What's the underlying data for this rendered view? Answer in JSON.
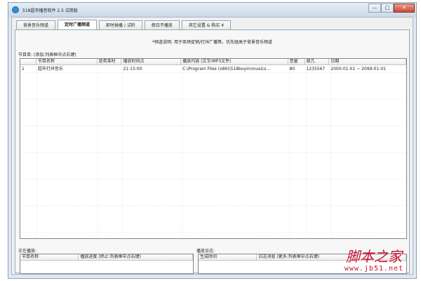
{
  "window": {
    "title": "518超市播音软件 2.5 试用版",
    "min_label": "—",
    "max_label": "□",
    "close_label": "✕"
  },
  "tabs": [
    {
      "label": "背景音乐频道",
      "active": false
    },
    {
      "label": "定时广播频道",
      "active": true
    },
    {
      "label": "即时插播 / 试听",
      "active": false
    },
    {
      "label": "假日不播放",
      "active": false
    },
    {
      "label": "其它设置 & 购买 ¥",
      "active": false
    }
  ],
  "main": {
    "hint": "*频道说明: 用于商场促销/打烊广播等。优先级高于背景音乐频道",
    "list_label": "节目单: (添加:列表框中点右键)",
    "columns": [
      "",
      "节目名称",
      "是否准时",
      "播放时间点",
      "播放内容 (文字/MP3文件)",
      "音量",
      "周几",
      "日期"
    ],
    "rows": [
      [
        "1",
        "超市打烊音乐",
        "",
        "21:15:00",
        "C:\\Program Files (x86)\\518boyin\\musics...",
        "80",
        "1235567",
        "2000-01-01 ~ 2099-01-01"
      ]
    ]
  },
  "now_playing": {
    "label": "正在播放:",
    "columns": [
      "节目名称",
      "播放进度 (终止:列表框中点右键)"
    ]
  },
  "log": {
    "label": "播放日志:",
    "columns": [
      "生成时间",
      "日志消息 (更多:列表框中点右键)"
    ]
  },
  "watermark": {
    "text": "脚本之家",
    "url": "www.jb51.net"
  }
}
